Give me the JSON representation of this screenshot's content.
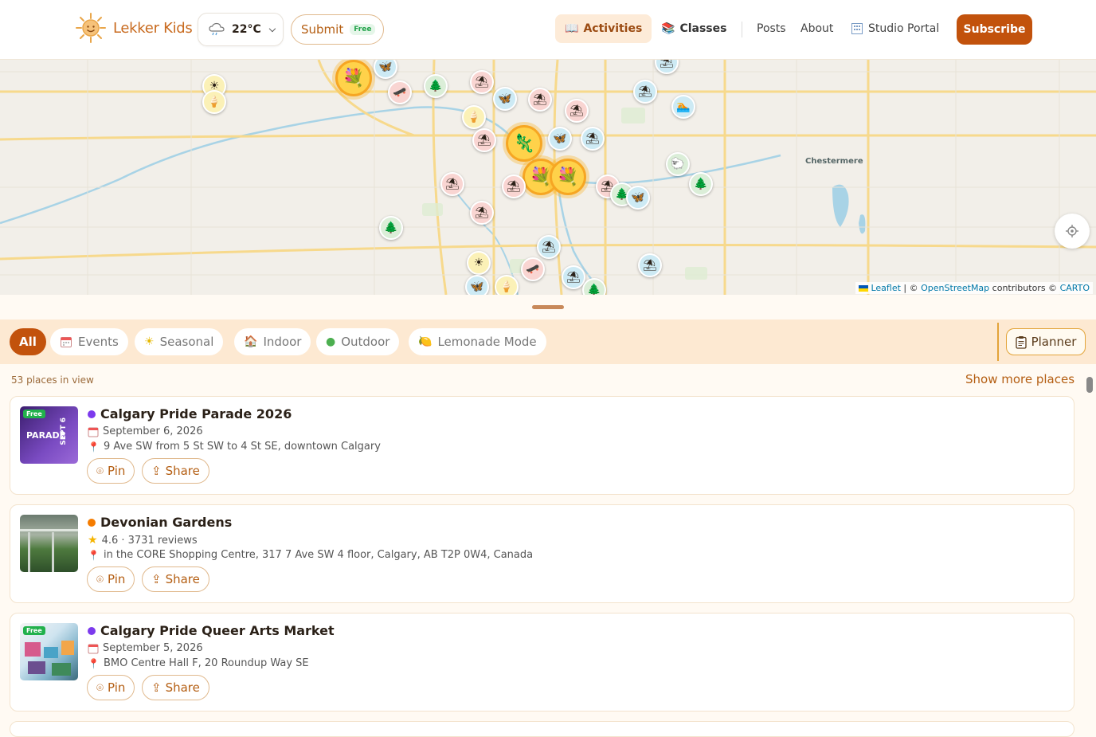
{
  "header": {
    "brand": "Lekker Kids",
    "weather_temp": "22°C",
    "submit_label": "Submit",
    "submit_badge": "Free",
    "nav": {
      "activities": "Activities",
      "classes": "Classes",
      "posts": "Posts",
      "about": "About",
      "studio_portal": "Studio Portal"
    },
    "subscribe_label": "Subscribe"
  },
  "map": {
    "town_label": "Chestermere",
    "attribution": {
      "leaflet": "Leaflet",
      "sep": " | © ",
      "osm": "OpenStreetMap",
      "contributors": " contributors © ",
      "carto": "CARTO"
    },
    "colors": {
      "marker_highlight": "#ffd24a",
      "road": "#f7d98c",
      "water": "#a8d3e6"
    }
  },
  "filters": {
    "chips": [
      {
        "label": "All",
        "icon": ""
      },
      {
        "label": "Events",
        "icon": "calendar-icon"
      },
      {
        "label": "Seasonal",
        "icon": "sun-icon"
      },
      {
        "label": "Indoor",
        "icon": "house-icon"
      },
      {
        "label": "Outdoor",
        "icon": "tree-icon"
      },
      {
        "label": "Lemonade Mode",
        "icon": "lemon-icon"
      }
    ],
    "planner_label": "Planner"
  },
  "list": {
    "count_text": "53 places in view",
    "show_more": "Show more places",
    "items": [
      {
        "title": "Calgary Pride Parade 2026",
        "dot_color": "#7c3aed",
        "line1": "September 6, 2026",
        "line1_icon": "calendar-icon",
        "address": "9 Ave SW from 5 St SW to 4 St SE, downtown Calgary",
        "free_badge": "Free",
        "pin": "Pin",
        "share": "Share"
      },
      {
        "title": "Devonian Gardens",
        "dot_color": "#f57c00",
        "line1": "4.6 · 3731 reviews",
        "line1_icon": "star-icon",
        "address": "in the CORE Shopping Centre, 317 7 Ave SW 4 floor, Calgary, AB T2P 0W4, Canada",
        "free_badge": "",
        "pin": "Pin",
        "share": "Share"
      },
      {
        "title": "Calgary Pride Queer Arts Market",
        "dot_color": "#7c3aed",
        "line1": "September 5, 2026",
        "line1_icon": "calendar-icon",
        "address": "BMO Centre Hall F, 20 Roundup Way SE",
        "free_badge": "Free",
        "pin": "Pin",
        "share": "Share"
      }
    ]
  }
}
